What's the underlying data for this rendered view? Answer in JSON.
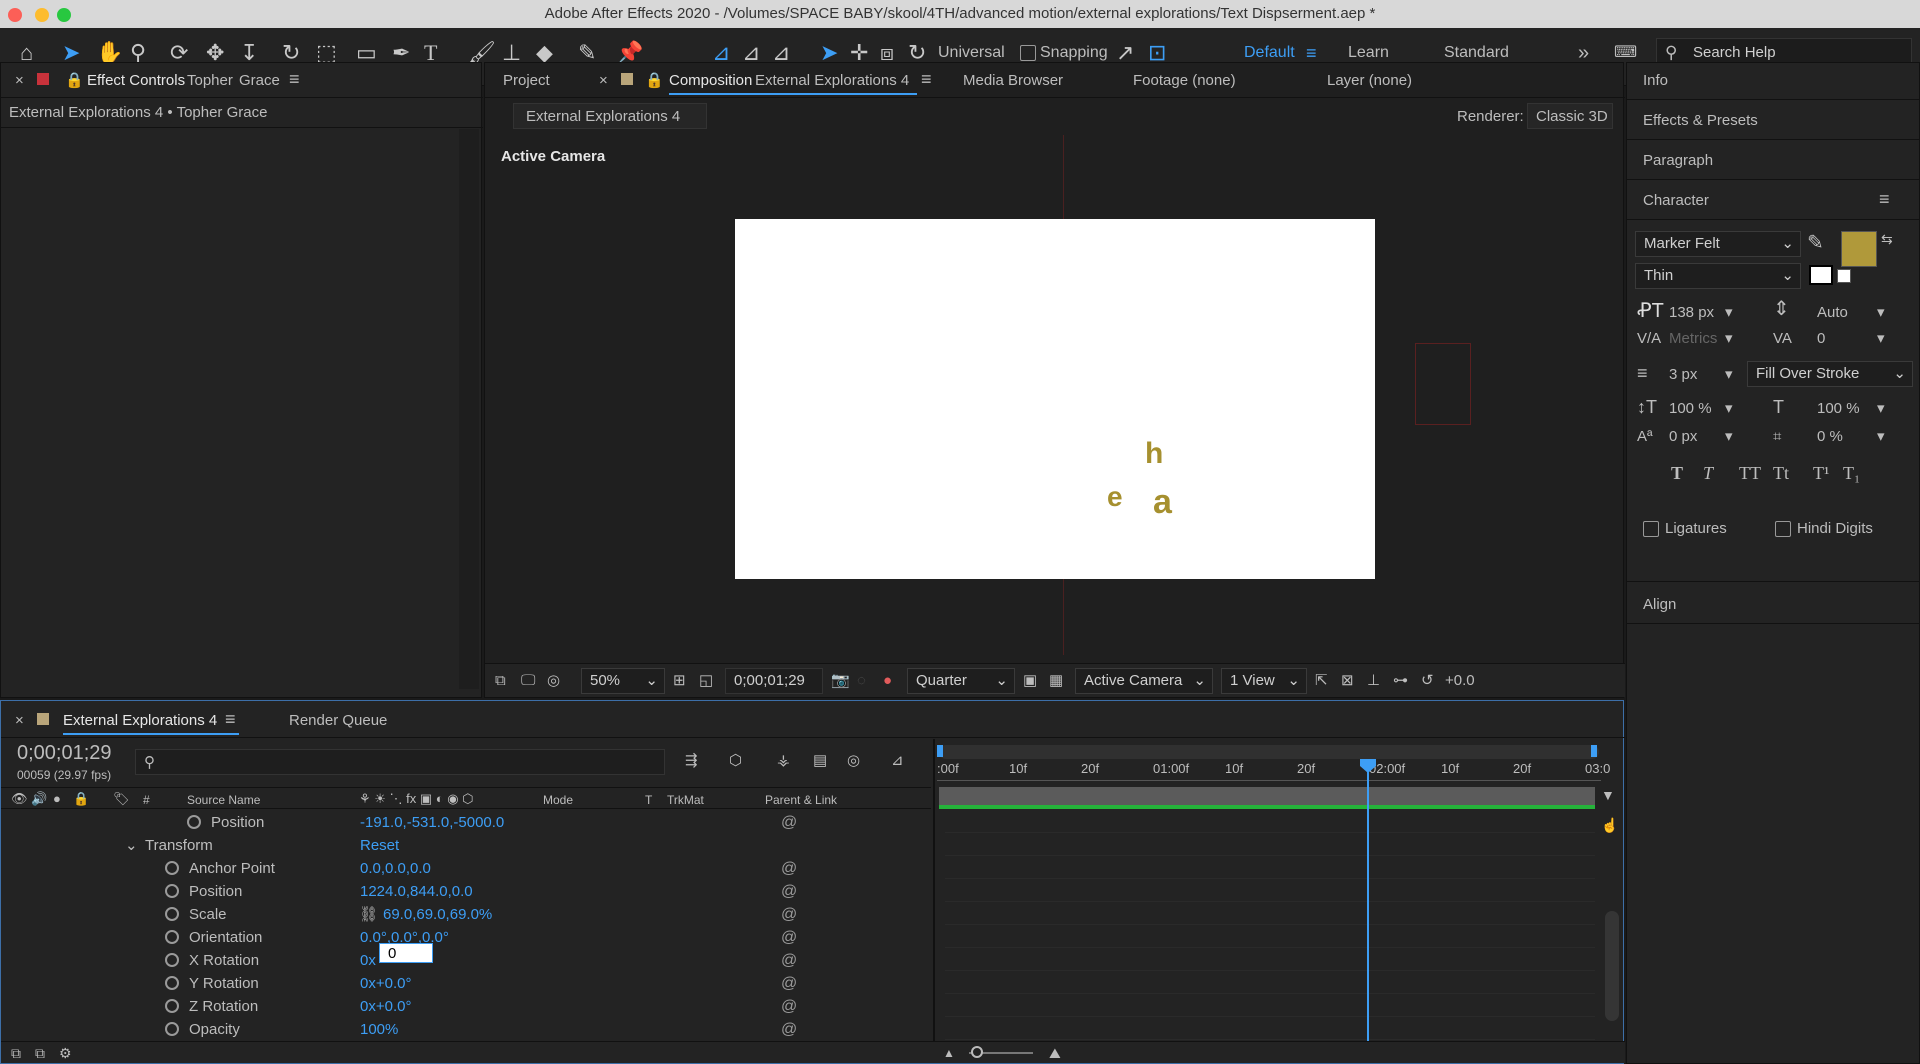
{
  "window": {
    "title": "Adobe After Effects 2020 - /Volumes/SPACE BABY/skool/4TH/advanced motion/external explorations/Text Dispserment.aep *"
  },
  "toolbar": {
    "universal": "Universal",
    "snapping": "Snapping",
    "workspaces": [
      "Default",
      "Learn",
      "Standard"
    ],
    "search_help": "Search Help"
  },
  "effect_controls": {
    "title": "Effect Controls",
    "layer_first": "Topher",
    "layer_second": "Grace",
    "breadcrumb": "External Explorations 4 • Topher  Grace"
  },
  "comp_panel": {
    "tab_project": "Project",
    "tab_comp_prefix": "Composition",
    "tab_comp_name": "External Explorations 4",
    "tab_media": "Media Browser",
    "tab_footage": "Footage (none)",
    "tab_layer": "Layer (none)",
    "comp_chip": "External Explorations 4",
    "renderer_label": "Renderer:",
    "renderer_value": "Classic 3D",
    "active_camera": "Active Camera",
    "canvas_letters": [
      "h",
      "e",
      "a"
    ]
  },
  "viewer_bar": {
    "zoom": "50%",
    "timecode": "0;00;01;29",
    "resolution": "Quarter",
    "camera": "Active Camera",
    "views": "1 View",
    "exposure": "+0.0"
  },
  "right_panel": {
    "info": "Info",
    "effects": "Effects & Presets",
    "paragraph": "Paragraph",
    "character": "Character",
    "font": "Marker Felt",
    "style": "Thin",
    "font_size": "138 px",
    "leading": "Auto",
    "kerning": "Metrics",
    "tracking": "0",
    "stroke": "3 px",
    "stroke_mode": "Fill Over Stroke",
    "vscale": "100 %",
    "hscale": "100 %",
    "baseline": "0 px",
    "tsume": "0 %",
    "ligatures": "Ligatures",
    "hindi": "Hindi Digits",
    "align": "Align",
    "fill_color": "#b0993a",
    "styles": [
      "T",
      "T",
      "TT",
      "Tt",
      "T¹",
      "T₁"
    ]
  },
  "timeline": {
    "tab": "External Explorations 4",
    "render_queue": "Render Queue",
    "timecode": "0;00;01;29",
    "frames": "00059 (29.97 fps)",
    "col_source": "Source Name",
    "col_mode": "Mode",
    "col_t": "T",
    "col_trkmat": "TrkMat",
    "col_parent": "Parent & Link",
    "col_hash": "#",
    "ruler": [
      ":00f",
      "10f",
      "20f",
      "01:00f",
      "10f",
      "20f",
      "02:00f",
      "10f",
      "20f",
      "03:0"
    ],
    "rows": [
      {
        "name": "Position",
        "value": "-191.0,-531.0,-5000.0",
        "indent": "sub"
      },
      {
        "name": "Transform",
        "value": "Reset",
        "indent": "group"
      },
      {
        "name": "Anchor Point",
        "value": "0.0,0.0,0.0",
        "indent": "prop"
      },
      {
        "name": "Position",
        "value": "1224.0,844.0,0.0",
        "indent": "prop"
      },
      {
        "name": "Scale",
        "value": "69.0,69.0,69.0%",
        "indent": "prop"
      },
      {
        "name": "Orientation",
        "value": "0.0°,0.0°,0.0°",
        "indent": "prop"
      },
      {
        "name": "X Rotation",
        "value": "0x",
        "indent": "prop"
      },
      {
        "name": "Y Rotation",
        "value": "0x+0.0°",
        "indent": "prop"
      },
      {
        "name": "Z Rotation",
        "value": "0x+0.0°",
        "indent": "prop"
      },
      {
        "name": "Opacity",
        "value": "100%",
        "indent": "prop"
      }
    ],
    "xrot_input": "0"
  }
}
